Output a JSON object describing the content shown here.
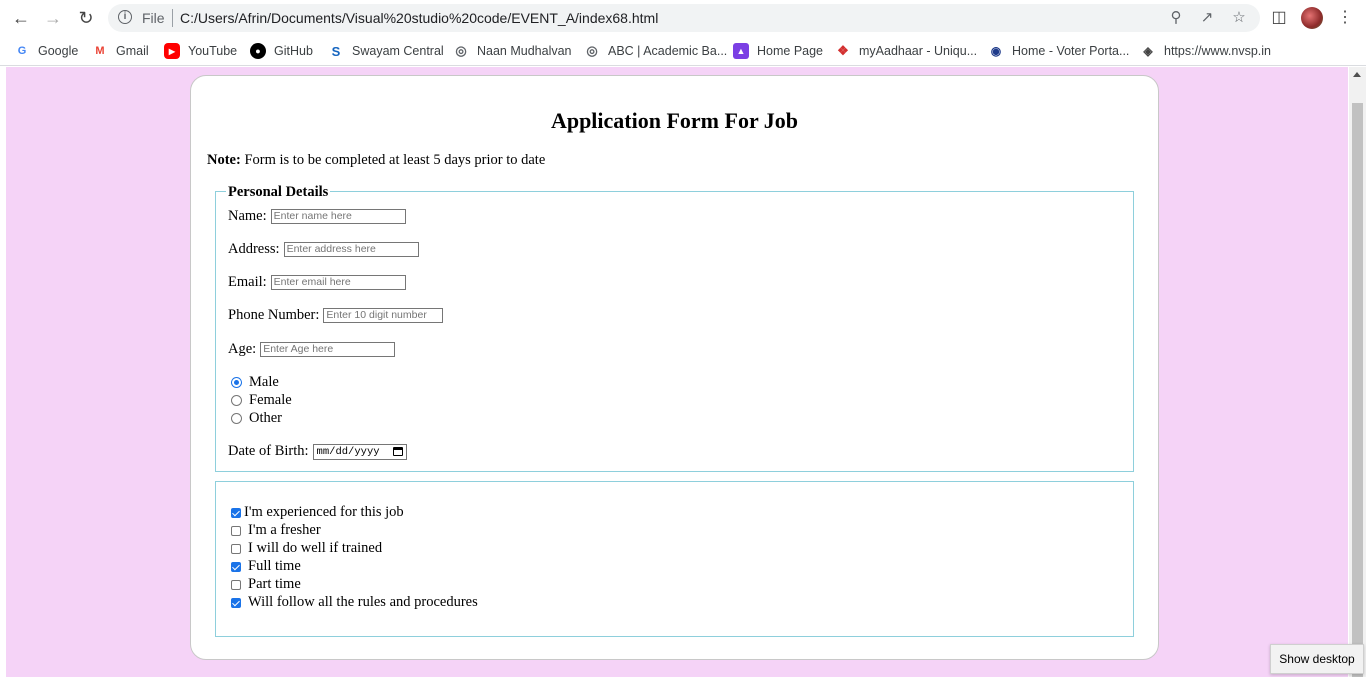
{
  "browser": {
    "file_label": "File",
    "url": "C:/Users/Afrin/Documents/Visual%20studio%20code/EVENT_A/index68.html"
  },
  "bookmarks": [
    {
      "label": "Google",
      "icon": "google-icon",
      "color": "#4285f4"
    },
    {
      "label": "Gmail",
      "icon": "gmail-icon",
      "color": "#ea4335"
    },
    {
      "label": "YouTube",
      "icon": "youtube-icon",
      "color": "#ff0000"
    },
    {
      "label": "GitHub",
      "icon": "github-icon",
      "color": "#000000"
    },
    {
      "label": "Swayam Central",
      "icon": "swayam-icon",
      "color": "#1565c0"
    },
    {
      "label": "Naan Mudhalvan",
      "icon": "globe-icon",
      "color": "#5f6368"
    },
    {
      "label": "ABC | Academic Ba...",
      "icon": "globe-icon",
      "color": "#5f6368"
    },
    {
      "label": "Home Page",
      "icon": "home-page-icon",
      "color": "#7b3fe4"
    },
    {
      "label": "myAadhaar - Uniqu...",
      "icon": "aadhaar-icon",
      "color": "#d32f2f"
    },
    {
      "label": "Home - Voter Porta...",
      "icon": "voter-icon",
      "color": "#1e3a8a"
    },
    {
      "label": "https://www.nvsp.in",
      "icon": "nvsp-icon",
      "color": "#444444"
    }
  ],
  "form": {
    "title": "Application Form For Job",
    "note_label": "Note:",
    "note_text": " Form is to be completed at least 5 days prior to date",
    "personal_legend": "Personal Details",
    "fields": {
      "name_label": "Name:",
      "name_placeholder": "Enter name here",
      "address_label": "Address:",
      "address_placeholder": "Enter address here",
      "email_label": "Email:",
      "email_placeholder": "Enter email here",
      "phone_label": "Phone Number:",
      "phone_placeholder": "Enter 10 digit number",
      "age_label": "Age:",
      "age_placeholder": "Enter Age here",
      "dob_label": "Date of Birth:",
      "dob_placeholder": "mm/dd/yyyy"
    },
    "gender_options": [
      {
        "label": "Male",
        "checked": true
      },
      {
        "label": "Female",
        "checked": false
      },
      {
        "label": "Other",
        "checked": false
      }
    ],
    "checkboxes": [
      {
        "label": "I'm experienced for this job",
        "checked": true
      },
      {
        "label": "I'm a fresher",
        "checked": false
      },
      {
        "label": "I will do well if trained",
        "checked": false
      },
      {
        "label": "Full time",
        "checked": true
      },
      {
        "label": "Part time",
        "checked": false
      },
      {
        "label": "Will follow all the rules and procedures",
        "checked": true
      }
    ]
  },
  "tooltip": "Show desktop",
  "colors": {
    "page_background": "#f5d3f7",
    "fieldset_border": "#8ecfdc",
    "accent": "#1a73e8"
  }
}
